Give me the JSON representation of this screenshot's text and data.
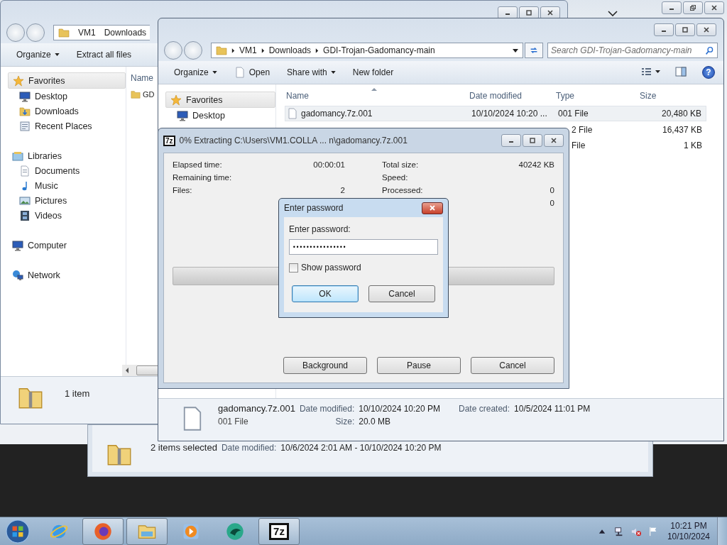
{
  "explorer_back": {
    "address": [
      "VM1",
      "Downloads"
    ],
    "toolbar": [
      {
        "label": "Organize",
        "kind": "menu"
      },
      {
        "label": "Extract all files",
        "kind": "plain"
      }
    ],
    "nav": [
      {
        "label": "Favorites",
        "kind": "favorites",
        "selected": true,
        "children": [
          {
            "label": "Desktop",
            "kind": "desktop",
            "selected": false
          },
          {
            "label": "Downloads",
            "kind": "downloads",
            "selected": false
          },
          {
            "label": "Recent Places",
            "kind": "recent",
            "selected": false
          }
        ]
      },
      {
        "label": "Libraries",
        "kind": "library",
        "selected": false,
        "children": [
          {
            "label": "Documents",
            "kind": "documents",
            "selected": false
          },
          {
            "label": "Music",
            "kind": "music",
            "selected": false
          },
          {
            "label": "Pictures",
            "kind": "pictures",
            "selected": false
          },
          {
            "label": "Videos",
            "kind": "videos",
            "selected": false
          }
        ]
      },
      {
        "label": "Computer",
        "kind": "computer",
        "selected": false
      },
      {
        "label": "Network",
        "kind": "network",
        "selected": false
      }
    ],
    "columns": [
      "Name"
    ],
    "rows": [
      {
        "name": "GD"
      }
    ],
    "status": "1 item"
  },
  "explorer_front": {
    "address": [
      "VM1",
      "Downloads",
      "GDI-Trojan-Gadomancy-main"
    ],
    "search": {
      "placeholder": "Search GDI-Trojan-Gadomancy-main"
    },
    "toolbar": [
      {
        "label": "Organize",
        "kind": "menu"
      },
      {
        "label": "Open",
        "kind": "open"
      },
      {
        "label": "Share with",
        "kind": "menu"
      },
      {
        "label": "New folder",
        "kind": "plain"
      }
    ],
    "help": "?",
    "nav": [
      {
        "label": "Favorites",
        "kind": "favorites",
        "selected": true,
        "children": [
          {
            "label": "Desktop",
            "kind": "desktop",
            "selected": false
          }
        ]
      }
    ],
    "columns": [
      "Name",
      "Date modified",
      "Type",
      "Size"
    ],
    "rows": [
      {
        "name": "gadomancy.7z.001",
        "date": "10/10/2024 10:20 ...",
        "type": "001 File",
        "size": "20,480 KB",
        "selected": true
      },
      {
        "type": "2 File",
        "size": "16,437 KB",
        "selected": false
      },
      {
        "type": "File",
        "size": "1 KB",
        "selected": false
      }
    ],
    "details": {
      "name": "gadomancy.7z.001",
      "type": "001 File",
      "rows": [
        [
          {
            "label": "Date modified:",
            "value": "10/10/2024 10:20 PM"
          },
          {
            "label": "Date created:",
            "value": "10/5/2024 11:01 PM"
          }
        ],
        [
          {
            "label": "Size:",
            "value": "20.0 MB"
          }
        ]
      ]
    }
  },
  "explorer_third": {
    "status": "2 items selected",
    "fields": [
      {
        "label": "Date modified:",
        "value": "10/6/2024 2:01 AM - 10/10/2024 10:20 PM"
      }
    ]
  },
  "extract_dialog": {
    "app_icon": "7z",
    "title": "0% Extracting C:\\Users\\VM1.COLLA ... n\\gadomancy.7z.001",
    "left_stats": [
      {
        "label": "Elapsed time:",
        "value": "00:00:01"
      },
      {
        "label": "Remaining time:"
      },
      {
        "label": "Files:",
        "value": "2"
      }
    ],
    "right_stats": [
      {
        "label": "Total size:",
        "value": "40242 KB"
      },
      {
        "label": "Speed:"
      },
      {
        "label": "Processed:",
        "value": "0"
      },
      {
        "value": "0"
      }
    ],
    "progress": {
      "level": 0
    },
    "buttons": [
      "Background",
      "Pause",
      "Cancel"
    ]
  },
  "password_dialog": {
    "title": "Enter password",
    "label": "Enter password:",
    "value": "••••••••••••••••",
    "show_password": {
      "label": "Show password",
      "checked": false
    },
    "buttons": [
      {
        "label": "OK",
        "default": true
      },
      {
        "label": "Cancel",
        "default": false
      }
    ]
  },
  "taskbar": {
    "items": [
      {
        "kind": "ie",
        "running": false
      },
      {
        "kind": "firefox",
        "running": true
      },
      {
        "kind": "explorer",
        "running": true
      },
      {
        "kind": "media",
        "running": false
      },
      {
        "kind": "app",
        "running": false
      },
      {
        "kind": "sevenzip",
        "running": true,
        "text": "7z"
      }
    ],
    "clock": {
      "time": "10:21 PM",
      "date": "10/10/2024"
    }
  }
}
